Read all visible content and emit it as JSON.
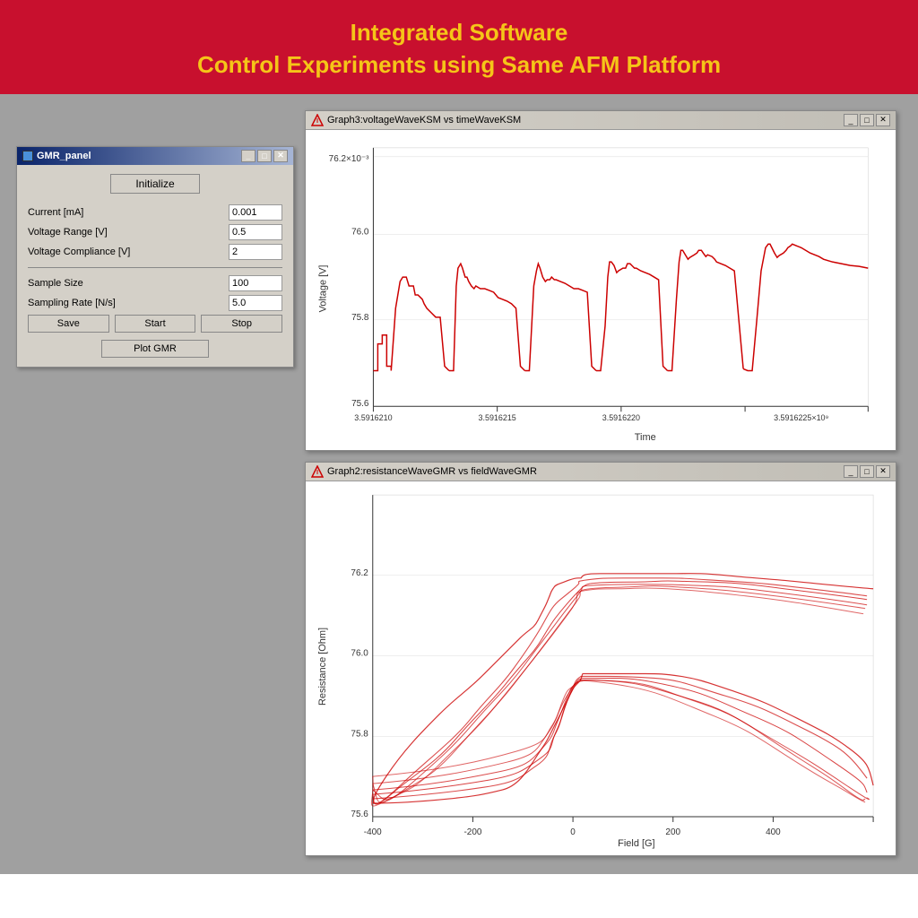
{
  "header": {
    "line1": "Integrated Software",
    "line2": "Control Experiments using Same AFM Platform"
  },
  "gmr_panel": {
    "title": "GMR_panel",
    "initialize_label": "Initialize",
    "fields": [
      {
        "label": "Current [mA]",
        "value": "0.001"
      },
      {
        "label": "Voltage Range [V]",
        "value": "0.5"
      },
      {
        "label": "Voltage Compliance [V]",
        "value": "2"
      }
    ],
    "fields2": [
      {
        "label": "Sample Size",
        "value": "100"
      },
      {
        "label": "Sampling Rate [N/s]",
        "value": "5.0"
      }
    ],
    "save_label": "Save",
    "start_label": "Start",
    "stop_label": "Stop",
    "plot_label": "Plot GMR"
  },
  "graph_top": {
    "title": "Graph3:voltageWaveKSM vs timeWaveKSM",
    "y_label": "Voltage [V]",
    "x_label": "Time",
    "y_ticks": [
      "75.6",
      "75.8",
      "76.0",
      "76.2x10⁻³"
    ],
    "x_ticks": [
      "3.5916210",
      "3.5916215",
      "3.5916220",
      "3.5916225x10⁹"
    ]
  },
  "graph_bottom": {
    "title": "Graph2:resistanceWaveGMR vs fieldWaveGMR",
    "y_label": "Resistance [Ohm]",
    "x_label": "Field [G]",
    "y_ticks": [
      "75.6",
      "75.8",
      "76.0",
      "76.2"
    ],
    "x_ticks": [
      "-400",
      "-200",
      "0",
      "200",
      "400"
    ]
  },
  "icons": {
    "minimize": "_",
    "restore": "□",
    "close": "✕",
    "graph_icon": "▲"
  }
}
